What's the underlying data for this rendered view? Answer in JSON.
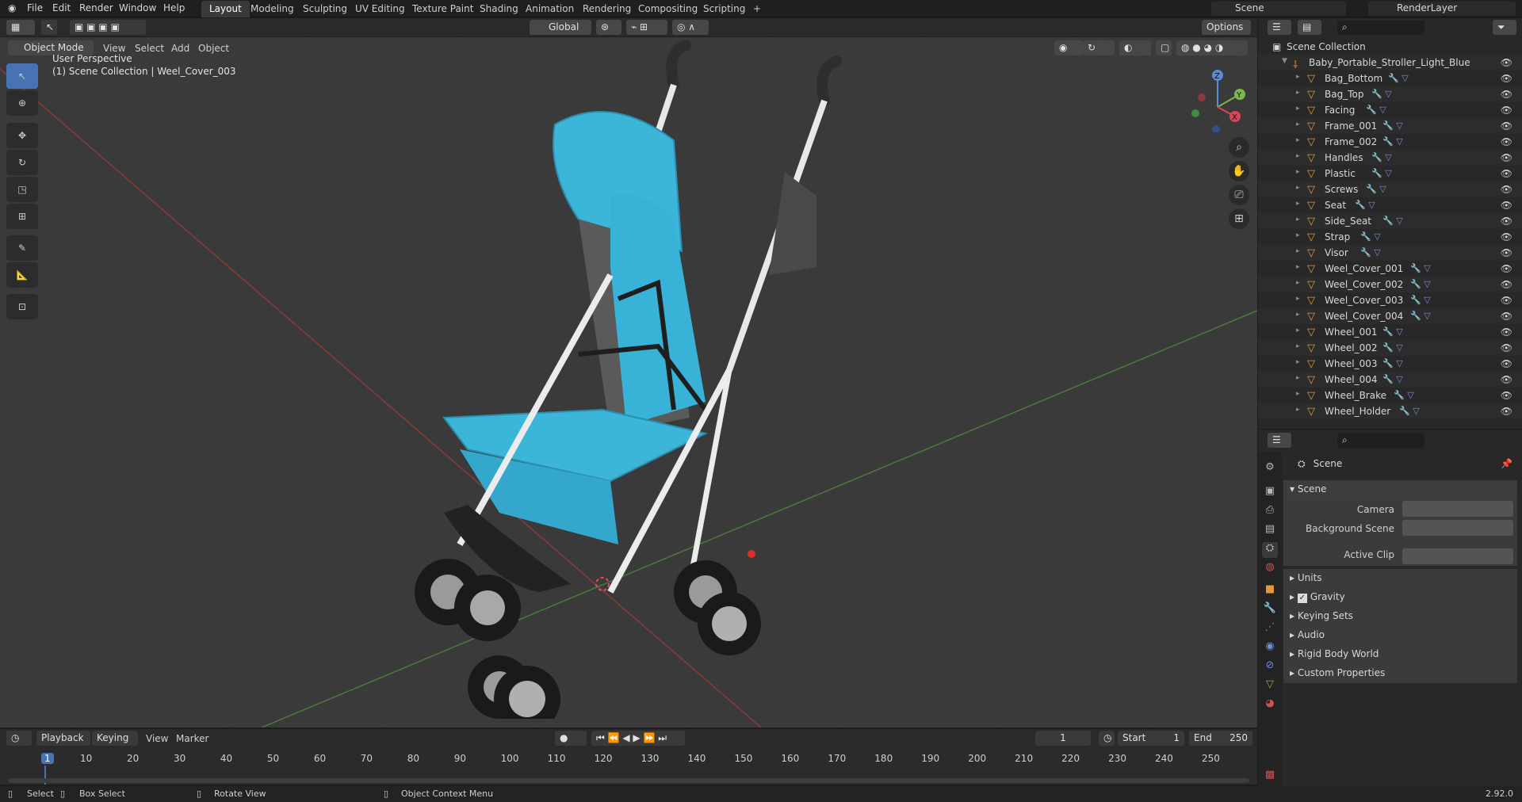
{
  "topbar": {
    "menus": [
      "File",
      "Edit",
      "Render",
      "Window",
      "Help"
    ],
    "workspaces": [
      "Layout",
      "Modeling",
      "Sculpting",
      "UV Editing",
      "Texture Paint",
      "Shading",
      "Animation",
      "Rendering",
      "Compositing",
      "Scripting"
    ],
    "add_tab": "+",
    "scene_name": "Scene",
    "view_layer": "RenderLayer"
  },
  "viewport_header": {
    "mode": "Object Mode",
    "menus": [
      "View",
      "Select",
      "Add",
      "Object"
    ],
    "orientation": "Global",
    "options": "Options"
  },
  "viewport": {
    "perspective": "User Perspective",
    "collection": "(1) Scene Collection | Weel_Cover_003"
  },
  "gizmo": {
    "x": "X",
    "y": "Y",
    "z": "Z"
  },
  "outliner": {
    "root": "Scene Collection",
    "collection": "Baby_Portable_Stroller_Light_Blue",
    "items": [
      "Bag_Bottom",
      "Bag_Top",
      "Facing",
      "Frame_001",
      "Frame_002",
      "Handles",
      "Plastic",
      "Screws",
      "Seat",
      "Side_Seat",
      "Strap",
      "Visor",
      "Weel_Cover_001",
      "Weel_Cover_002",
      "Weel_Cover_003",
      "Weel_Cover_004",
      "Wheel_001",
      "Wheel_002",
      "Wheel_003",
      "Wheel_004",
      "Wheel_Brake",
      "Wheel_Holder"
    ]
  },
  "properties": {
    "context": "Scene",
    "panel_title": "Scene",
    "camera_label": "Camera",
    "bg_scene_label": "Background Scene",
    "active_clip_label": "Active Clip",
    "subpanels": [
      "Units",
      "Gravity",
      "Keying Sets",
      "Audio",
      "Rigid Body World",
      "Custom Properties"
    ],
    "gravity_checked": true
  },
  "timeline": {
    "menus": [
      "Playback",
      "Keying",
      "View",
      "Marker"
    ],
    "current_frame": "1",
    "start_label": "Start",
    "start": "1",
    "end_label": "End",
    "end": "250",
    "ticks": [
      "1",
      "10",
      "20",
      "30",
      "40",
      "50",
      "60",
      "70",
      "80",
      "90",
      "100",
      "110",
      "120",
      "130",
      "140",
      "150",
      "160",
      "170",
      "180",
      "190",
      "200",
      "210",
      "220",
      "230",
      "240",
      "250"
    ]
  },
  "statusbar": {
    "select": "Select",
    "box_select": "Box Select",
    "rotate_view": "Rotate View",
    "context_menu": "Object Context Menu",
    "version": "2.92.0"
  },
  "colors": {
    "accent": "#4772b3",
    "object_orange": "#e8963c",
    "stroller_blue": "#3bb6d9",
    "grid_red": "#8a3a3a",
    "grid_green": "#4a7a3a"
  }
}
